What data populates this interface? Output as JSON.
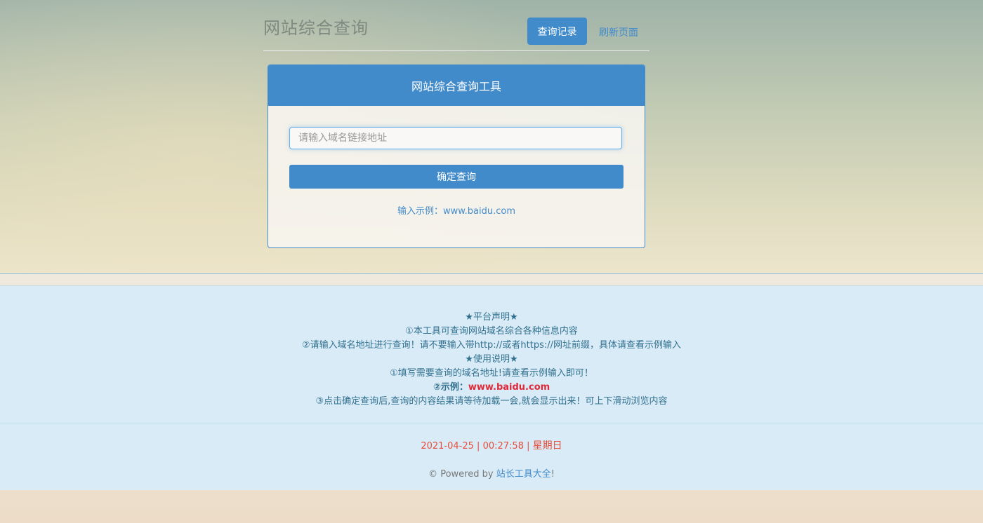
{
  "header": {
    "title": "网站综合查询",
    "records_button": "查询记录",
    "refresh_link": "刷新页面"
  },
  "panel": {
    "heading": "网站综合查询工具",
    "input_placeholder": "请输入域名链接地址",
    "input_value": "",
    "submit_button": "确定查询",
    "example_label": "输入示例：",
    "example_value": "www.baidu.com"
  },
  "notice": {
    "platform_heading": "★平台声明★",
    "platform_line1": "①本工具可查询网站域名综合各种信息内容",
    "platform_line2": "②请输入域名地址进行查询！请不要输入带http://或者https://网址前缀，具体请查看示例输入",
    "usage_heading": "★使用说明★",
    "usage_line1": "①填写需要查询的域名地址!请查看示例输入即可！",
    "usage_example_label": "②示例：",
    "usage_example_value": "www.baidu.com",
    "usage_line3": "③点击确定查询后,查询的内容结果请等待加载一会,就会显示出来！可上下滑动浏览内容"
  },
  "footer": {
    "date": "2021-04-25",
    "time": "00:27:58",
    "separator": "|",
    "weekday": "星期日",
    "powered_prefix": "© Powered by ",
    "powered_link": "站长工具大全",
    "powered_suffix": "!"
  },
  "colors": {
    "primary": "#428bca",
    "notice_text": "#31708f",
    "accent_red": "#e02a3a"
  }
}
